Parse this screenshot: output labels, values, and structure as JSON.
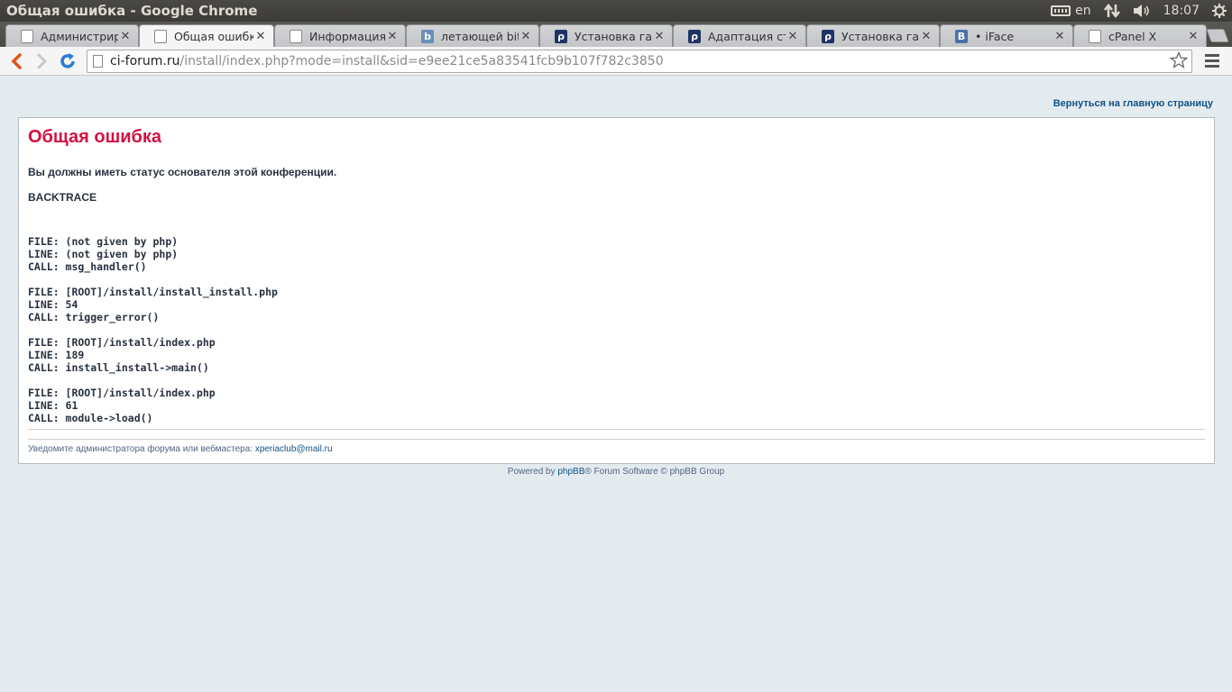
{
  "window": {
    "title": "Общая ошибка - Google Chrome",
    "language": "en",
    "clock": "18:07"
  },
  "tabs": [
    {
      "title": "Администриров",
      "favicon": "document-icon"
    },
    {
      "title": "Общая ошибка",
      "favicon": "document-icon",
      "active": true
    },
    {
      "title": "Информация - И",
      "favicon": "document-icon"
    },
    {
      "title": "летающей bits.o",
      "favicon": "bits-icon"
    },
    {
      "title": "Установка галер",
      "favicon": "p-icon"
    },
    {
      "title": "Адаптация станд",
      "favicon": "p-icon"
    },
    {
      "title": "Установка галер",
      "favicon": "p-icon"
    },
    {
      "title": "• iFace",
      "favicon": "vk-icon"
    },
    {
      "title": "cPanel X",
      "favicon": "document-icon"
    }
  ],
  "address_bar": {
    "host": "ci-forum.ru",
    "path": "/install/index.php?mode=install&sid=e9ee21ce5a83541fcb9b107f782c3850"
  },
  "page": {
    "back_link": "Вернуться на главную страницу",
    "error_title": "Общая ошибка",
    "error_message": "Вы должны иметь статус основателя этой конференции.",
    "backtrace_heading": "BACKTRACE",
    "backtrace": [
      {
        "file": "FILE: (not given by php)",
        "line": "LINE: (not given by php)",
        "call": "CALL: msg_handler()"
      },
      {
        "file": "FILE: [ROOT]/install/install_install.php",
        "line": "LINE: 54",
        "call": "CALL: trigger_error()"
      },
      {
        "file": "FILE: [ROOT]/install/index.php",
        "line": "LINE: 189",
        "call": "CALL: install_install->main()"
      },
      {
        "file": "FILE: [ROOT]/install/index.php",
        "line": "LINE: 61",
        "call": "CALL: module->load()"
      }
    ],
    "notice_text": "Уведомите администратора форума или вебмастера: ",
    "notice_email": "xperiaclub@mail.ru",
    "footer_prefix": "Powered by ",
    "footer_link": "phpBB",
    "footer_suffix": "® Forum Software © phpBB Group"
  },
  "colors": {
    "page_bg": "#e4ebef",
    "error_title": "#d31141",
    "link": "#105289",
    "back_arrow": "#e2541f",
    "reload": "#2c7ad6"
  }
}
